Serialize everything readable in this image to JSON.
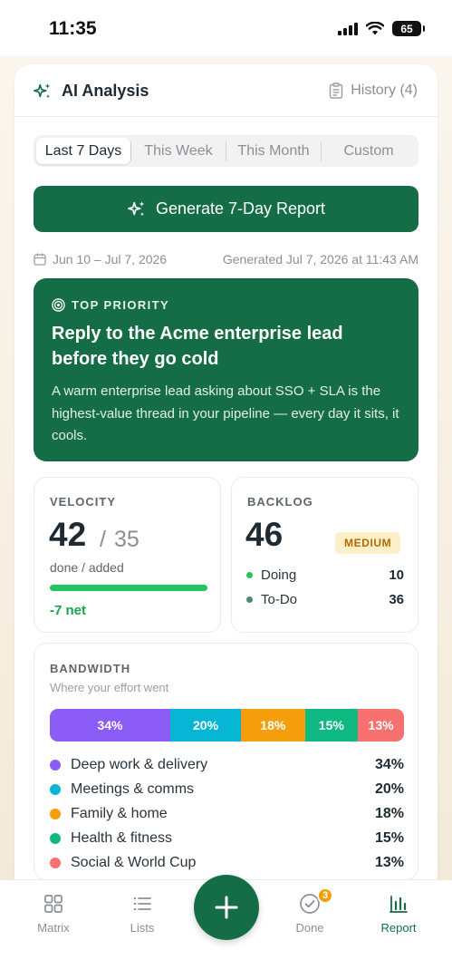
{
  "status_bar": {
    "time": "11:35",
    "battery": "65"
  },
  "header": {
    "title": "AI Analysis",
    "history_label": "History (4)"
  },
  "range_tabs": [
    {
      "label": "Last 7 Days",
      "active": true
    },
    {
      "label": "This Week",
      "active": false
    },
    {
      "label": "This Month",
      "active": false
    },
    {
      "label": "Custom",
      "active": false
    }
  ],
  "generate_button": {
    "label": "Generate 7-Day Report"
  },
  "meta": {
    "date_range": "Jun 10 – Jul 7, 2026",
    "generated": "Generated Jul 7, 2026 at 11:43 AM"
  },
  "priority": {
    "label": "TOP PRIORITY",
    "title": "Reply to the Acme enterprise lead before they go cold",
    "body": "A warm enterprise lead asking about SSO + SLA is the highest-value thread in your pipeline — every day it sits, it cools."
  },
  "velocity": {
    "label": "VELOCITY",
    "done": "42",
    "separator": "/",
    "added": "35",
    "sub": "done / added",
    "progress": 1.0,
    "net": "-7 net",
    "bar_color": "#22c55e"
  },
  "backlog": {
    "label": "BACKLOG",
    "total": "46",
    "badge": "MEDIUM",
    "rows": [
      {
        "label": "Doing",
        "value": "10",
        "color": "#22c55e"
      },
      {
        "label": "To-Do",
        "value": "36",
        "color": "#4c8a6b"
      }
    ]
  },
  "bandwidth": {
    "label": "BANDWIDTH",
    "subtitle": "Where your effort went",
    "segments": [
      {
        "name": "Deep work & delivery",
        "percent": 34,
        "pct_label": "34%",
        "color": "#8b5cf6"
      },
      {
        "name": "Meetings & comms",
        "percent": 20,
        "pct_label": "20%",
        "color": "#06b6d4"
      },
      {
        "name": "Family & home",
        "percent": 18,
        "pct_label": "18%",
        "color": "#f59e0b"
      },
      {
        "name": "Health & fitness",
        "percent": 15,
        "pct_label": "15%",
        "color": "#10b981"
      },
      {
        "name": "Social & World Cup",
        "percent": 13,
        "pct_label": "13%",
        "color": "#f87171"
      }
    ]
  },
  "tabbar": {
    "tabs": [
      {
        "label": "Matrix",
        "icon": "grid-icon",
        "active": false
      },
      {
        "label": "Lists",
        "icon": "list-icon",
        "active": false
      },
      {
        "label": "Done",
        "icon": "check-circle-icon",
        "active": false,
        "badge": "3"
      },
      {
        "label": "Report",
        "icon": "bar-chart-icon",
        "active": true
      }
    ],
    "fab_icon": "plus-icon"
  },
  "colors": {
    "brand_green": "#156d47",
    "badge_orange": "#f59e0b"
  }
}
